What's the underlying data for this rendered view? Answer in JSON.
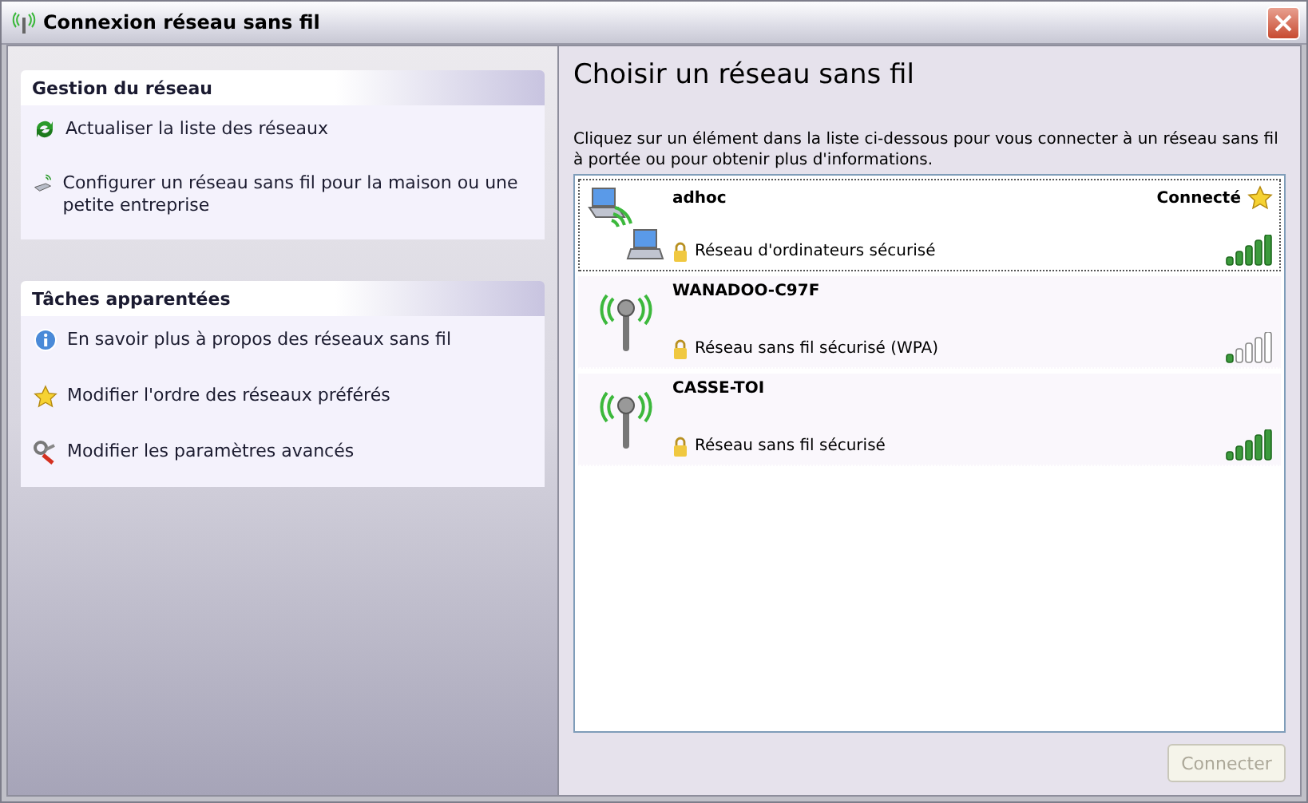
{
  "window": {
    "title": "Connexion réseau sans fil"
  },
  "sidebar": [
    {
      "title": "Gestion du réseau",
      "items": [
        {
          "kind": "refresh",
          "label": "Actualiser la liste des réseaux"
        },
        {
          "kind": "setup",
          "label": "Configurer un réseau sans fil pour la maison ou une petite entreprise"
        }
      ]
    },
    {
      "title": "Tâches apparentées",
      "items": [
        {
          "kind": "info",
          "label": "En savoir plus à propos des réseaux sans fil"
        },
        {
          "kind": "star",
          "label": "Modifier l'ordre des réseaux préférés"
        },
        {
          "kind": "tools",
          "label": "Modifier les paramètres avancés"
        }
      ]
    }
  ],
  "main": {
    "title": "Choisir un réseau sans fil",
    "instructions": "Cliquez sur un élément dans la liste ci-dessous pour vous connecter à un réseau sans fil à portée ou pour obtenir plus d'informations.",
    "networks": [
      {
        "kind": "adhoc",
        "name": "adhoc",
        "status": "Connecté",
        "preferred": true,
        "security": "Réseau d'ordinateurs sécurisé",
        "low_signal": false,
        "selected": true
      },
      {
        "kind": "access_point",
        "name": "WANADOO-C97F",
        "security": "Réseau sans fil sécurisé (WPA)",
        "low_signal": true,
        "preferred": false,
        "selected": false
      },
      {
        "kind": "access_point",
        "name": "CASSE-TOI",
        "security": "Réseau sans fil sécurisé",
        "low_signal": false,
        "preferred": false,
        "selected": false
      }
    ],
    "connect_button": {
      "label": "Connecter",
      "disabled": true
    }
  }
}
